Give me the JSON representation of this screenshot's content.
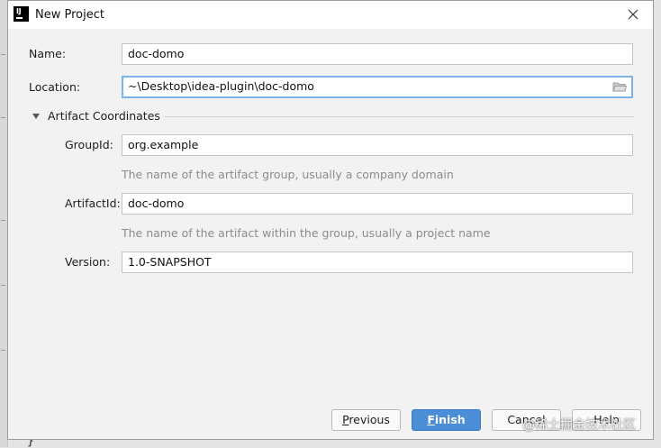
{
  "window": {
    "title": "New Project",
    "app_icon": "intellij-icon",
    "app_icon_text": "IJ"
  },
  "form": {
    "name": {
      "label": "Name:",
      "value": "doc-domo"
    },
    "location": {
      "label": "Location:",
      "value": "~\\Desktop\\idea-plugin\\doc-domo",
      "browse_icon": "folder-icon"
    },
    "section": {
      "title": "Artifact Coordinates",
      "expanded": true
    },
    "group_id": {
      "label": "GroupId:",
      "value": "org.example",
      "hint": "The name of the artifact group, usually a company domain"
    },
    "artifact_id": {
      "label": "ArtifactId:",
      "value": "doc-domo",
      "hint": "The name of the artifact within the group, usually a project name"
    },
    "version": {
      "label": "Version:",
      "value": "1.0-SNAPSHOT"
    }
  },
  "buttons": {
    "previous": {
      "mnemonic": "P",
      "rest": "revious"
    },
    "finish": {
      "mnemonic": "F",
      "rest": "inish"
    },
    "cancel": {
      "label": "Cancel"
    },
    "help": {
      "label": "Help"
    }
  },
  "watermark": "@稀土掘金技术社区",
  "colors": {
    "accent": "#4b8ed6",
    "focus_border": "#7eb3e6",
    "dialog_bg": "#f2f2f2"
  }
}
